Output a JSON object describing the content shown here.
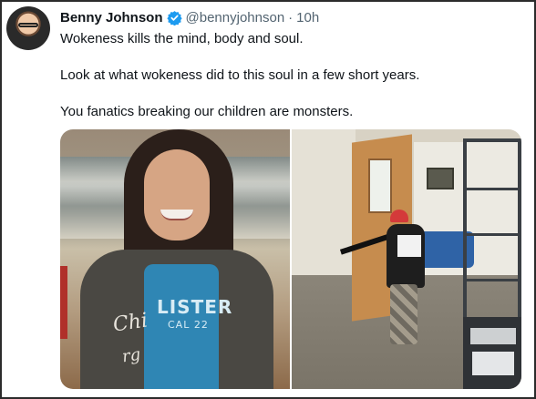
{
  "tweet": {
    "author_name": "Benny Johnson",
    "handle": "@bennyjohnson",
    "separator": "·",
    "time": "10h",
    "verified_icon": "verified-badge-icon",
    "avatar_icon": "user-avatar",
    "paragraphs": [
      "Wokeness kills the mind, body and soul.",
      "Look at what wokeness did to this soul in a few short years.",
      "You fanatics breaking our children are monsters."
    ]
  },
  "media": {
    "left_photo": {
      "shirt_text": "LISTER",
      "shirt_subtext": "CAL 22",
      "jacket_text_1": "Chi",
      "jacket_text_2": "rg"
    }
  },
  "colors": {
    "verified_blue": "#1d9bf0",
    "text_primary": "#0f1419",
    "text_secondary": "#536471"
  }
}
